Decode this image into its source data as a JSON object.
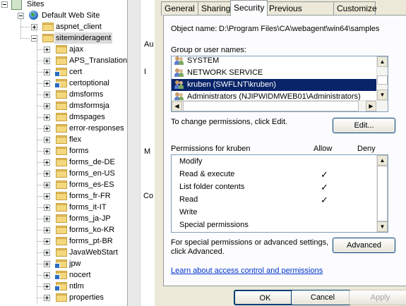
{
  "tree": {
    "root": {
      "label": "Sites",
      "icon": "sites-icon"
    },
    "site": {
      "label": "Default Web Site",
      "icon": "globe-icon"
    },
    "children": [
      {
        "label": "aspnet_client",
        "expander": "plus"
      },
      {
        "label": "siteminderagent",
        "expander": "minus",
        "selected": true
      }
    ],
    "folders": [
      {
        "label": "ajax",
        "app": false
      },
      {
        "label": "APS_Translation",
        "app": false
      },
      {
        "label": "cert",
        "app": true
      },
      {
        "label": "certoptional",
        "app": true
      },
      {
        "label": "dmsforms",
        "app": false
      },
      {
        "label": "dmsformsja",
        "app": false
      },
      {
        "label": "dmspages",
        "app": false
      },
      {
        "label": "error-responses",
        "app": false
      },
      {
        "label": "flex",
        "app": false
      },
      {
        "label": "forms",
        "app": false
      },
      {
        "label": "forms_de-DE",
        "app": false
      },
      {
        "label": "forms_en-US",
        "app": false
      },
      {
        "label": "forms_es-ES",
        "app": false
      },
      {
        "label": "forms_fr-FR",
        "app": false
      },
      {
        "label": "forms_it-IT",
        "app": false
      },
      {
        "label": "forms_ja-JP",
        "app": false
      },
      {
        "label": "forms_ko-KR",
        "app": false
      },
      {
        "label": "forms_pt-BR",
        "app": false
      },
      {
        "label": "JavaWebStart",
        "app": false
      },
      {
        "label": "jpw",
        "app": true
      },
      {
        "label": "nocert",
        "app": true
      },
      {
        "label": "ntlm",
        "app": true
      },
      {
        "label": "properties",
        "app": false
      }
    ]
  },
  "middle": {
    "frag1": "Au",
    "frag2": "I",
    "frag3": "M",
    "frag4": "Co"
  },
  "dialog": {
    "tabs": [
      {
        "label": "General",
        "active": false
      },
      {
        "label": "Sharing",
        "active": false
      },
      {
        "label": "Security",
        "active": true
      },
      {
        "label": "Previous Versions",
        "active": false
      },
      {
        "label": "Customize",
        "active": false
      }
    ],
    "object_name_label": "Object name:",
    "object_name_value": "D:\\Program Files\\CA\\webagent\\win64\\samples",
    "group_label": "Group or user names:",
    "groups": [
      {
        "label": "SYSTEM",
        "selected": false
      },
      {
        "label": "NETWORK SERVICE",
        "selected": false
      },
      {
        "label": "kruben (SWFLNT\\kruben)",
        "selected": true
      },
      {
        "label": "Administrators (NJIPWIDMWEB01\\Administrators)",
        "selected": false
      }
    ],
    "change_text": "To change permissions, click Edit.",
    "edit_button": "Edit...",
    "permissions_label": "Permissions for kruben",
    "allow_label": "Allow",
    "deny_label": "Deny",
    "permissions": [
      {
        "name": "Modify",
        "allow": false,
        "deny": false
      },
      {
        "name": "Read & execute",
        "allow": true,
        "deny": false
      },
      {
        "name": "List folder contents",
        "allow": true,
        "deny": false
      },
      {
        "name": "Read",
        "allow": true,
        "deny": false
      },
      {
        "name": "Write",
        "allow": false,
        "deny": false
      },
      {
        "name": "Special permissions",
        "allow": false,
        "deny": false
      }
    ],
    "check_glyph": "✓",
    "special_text_1": "For special permissions or advanced settings,",
    "special_text_2": "click Advanced.",
    "advanced_button": "Advanced",
    "learn_link": "Learn about access control and permissions",
    "ok_button": "OK",
    "cancel_button": "Cancel",
    "apply_button": "Apply",
    "colors": {
      "selection": "#0a246a",
      "dialog_bg": "#ece9d8",
      "link": "#0033cc"
    }
  }
}
